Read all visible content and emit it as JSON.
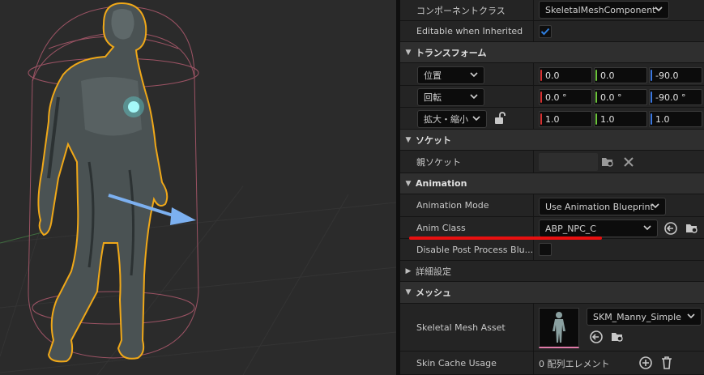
{
  "viewport": {
    "figure": "skeletal-mesh-character",
    "accent_outline": "#f0a818",
    "capsule_color": "#b05a6e",
    "arrow_color": "#7cb0f0",
    "chest_glow": "#5ee8e8"
  },
  "details": {
    "component_class": {
      "label": "コンポーネントクラス",
      "value": "SkeletalMeshComponent"
    },
    "editable_when_inherited": {
      "label": "Editable when Inherited",
      "checked": true
    },
    "transform": {
      "title": "トランスフォーム",
      "location": {
        "label": "位置",
        "x": "0.0",
        "y": "0.0",
        "z": "-90.0"
      },
      "rotation": {
        "label": "回転",
        "x": "0.0 °",
        "y": "0.0 °",
        "z": "-90.0 °"
      },
      "scale": {
        "label": "拡大・縮小",
        "x": "1.0",
        "y": "1.0",
        "z": "1.0"
      }
    },
    "socket": {
      "title": "ソケット",
      "parent_socket": {
        "label": "親ソケット",
        "value": ""
      }
    },
    "animation": {
      "title": "Animation",
      "mode": {
        "label": "Animation Mode",
        "value": "Use Animation Blueprint"
      },
      "anim_class": {
        "label": "Anim Class",
        "value": "ABP_NPC_C"
      },
      "disable_post_process": {
        "label": "Disable Post Process Blu...",
        "checked": false
      }
    },
    "advanced": {
      "title": "詳細設定"
    },
    "mesh": {
      "title": "メッシュ",
      "skeletal_mesh_asset": {
        "label": "Skeletal Mesh Asset",
        "value": "SKM_Manny_Simple"
      },
      "skin_cache_usage": {
        "label": "Skin Cache Usage",
        "value": "0 配列エレメント"
      }
    },
    "colors": {
      "axis_x": "#d63232",
      "axis_y": "#6cc43c",
      "axis_z": "#3c78e0",
      "checkbox_accent": "#2f7fe0",
      "annotation_red": "#e81010"
    }
  }
}
